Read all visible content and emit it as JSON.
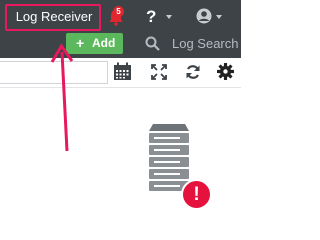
{
  "header": {
    "log_receiver_label": "Log Receiver",
    "notification_count": "5",
    "help_label": "?",
    "user_icon": "user-circle-icon"
  },
  "subheader": {
    "add_label": "Add",
    "add_icon": "+",
    "search_placeholder": "Log Search"
  },
  "toolbar": {
    "icons": [
      "calendar-icon",
      "expand-icon",
      "refresh-icon",
      "gear-icon"
    ]
  },
  "main": {
    "alert_symbol": "!",
    "server_icon": "server-icon"
  },
  "colors": {
    "header_bg": "#3e4348",
    "add_button": "#5cb85c",
    "highlight": "#e8185c",
    "alert": "#e5123e",
    "badge": "#e0262f"
  }
}
